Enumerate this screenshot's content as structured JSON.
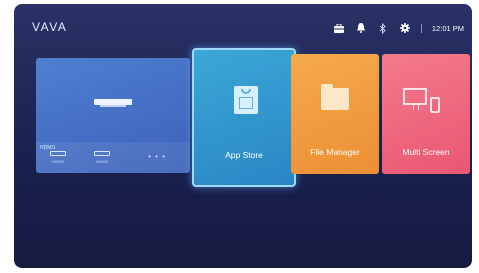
{
  "brand": {
    "logo": "VAVA"
  },
  "status_bar": {
    "icons": [
      "toolbox-icon",
      "bell-icon",
      "bluetooth-icon",
      "gear-icon"
    ],
    "time": "12:01 PM"
  },
  "tiles": {
    "hdmi": {
      "label": "HDMI1",
      "sub_items": [
        {
          "label": "HDMI2",
          "icon": "hdmi-port-icon"
        },
        {
          "label": "HDMI3",
          "icon": "hdmi-port-icon"
        }
      ],
      "more": "• • •"
    },
    "app_store": {
      "label": "App Store",
      "selected": true
    },
    "file_manager": {
      "label": "File Manager"
    },
    "multi_screen": {
      "label": "Multi Screen"
    }
  },
  "colors": {
    "background": "#1f2658",
    "hdmi_tile": "#4a78cc",
    "app_store_tile": "#2f96cd",
    "file_manager_tile": "#f19f42",
    "multi_screen_tile": "#ef6a80"
  }
}
